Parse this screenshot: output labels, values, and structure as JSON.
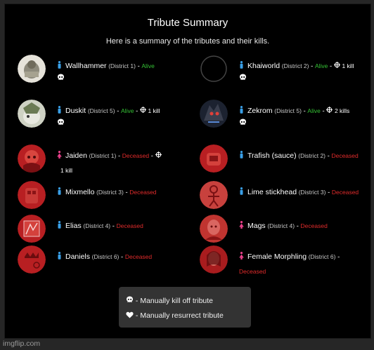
{
  "header": {
    "title": "Tribute Summary",
    "subtitle": "Here is a summary of the tributes and their kills."
  },
  "tributes": [
    {
      "name": "Wallhammer",
      "district": "(District 1)",
      "status": "Alive",
      "kills": "",
      "gender": "male"
    },
    {
      "name": "Khaiworld",
      "district": "(District 2)",
      "status": "Alive",
      "kills": "1 kill",
      "gender": "male"
    },
    {
      "name": "Duskit",
      "district": "(District 5)",
      "status": "Alive",
      "kills": "1 kill",
      "gender": "male"
    },
    {
      "name": "Zekrom",
      "district": "(District 5)",
      "status": "Alive",
      "kills": "2 kills",
      "gender": "male"
    },
    {
      "name": "Jaiden",
      "district": "(District 1)",
      "status": "Deceased",
      "kills": "1 kill",
      "gender": "female"
    },
    {
      "name": "Trafish (sauce)",
      "district": "(District 2)",
      "status": "Deceased",
      "kills": "",
      "gender": "male"
    },
    {
      "name": "Mixmello",
      "district": "(District 3)",
      "status": "Deceased",
      "kills": "",
      "gender": "male"
    },
    {
      "name": "Lime stickhead",
      "district": "(District 3)",
      "status": "Deceased",
      "kills": "",
      "gender": "male"
    },
    {
      "name": "Elias",
      "district": "(District 4)",
      "status": "Deceased",
      "kills": "",
      "gender": "male"
    },
    {
      "name": "Mags",
      "district": "(District 4)",
      "status": "Deceased",
      "kills": "",
      "gender": "female"
    },
    {
      "name": "Daniels",
      "district": "(District 6)",
      "status": "Deceased",
      "kills": "",
      "gender": "male"
    },
    {
      "name": "Female Morphling",
      "district": "(District 6)",
      "status": "Deceased",
      "kills": "",
      "gender": "female"
    }
  ],
  "separator": "-",
  "legend": {
    "kill_label": "- Manually kill off tribute",
    "resurrect_label": "- Manually resurrect tribute"
  },
  "watermark": "imgflip.com",
  "colors": {
    "alive": "#35c235",
    "deceased": "#e02b2b",
    "male": "#3aa0e8",
    "female": "#e8408a"
  }
}
